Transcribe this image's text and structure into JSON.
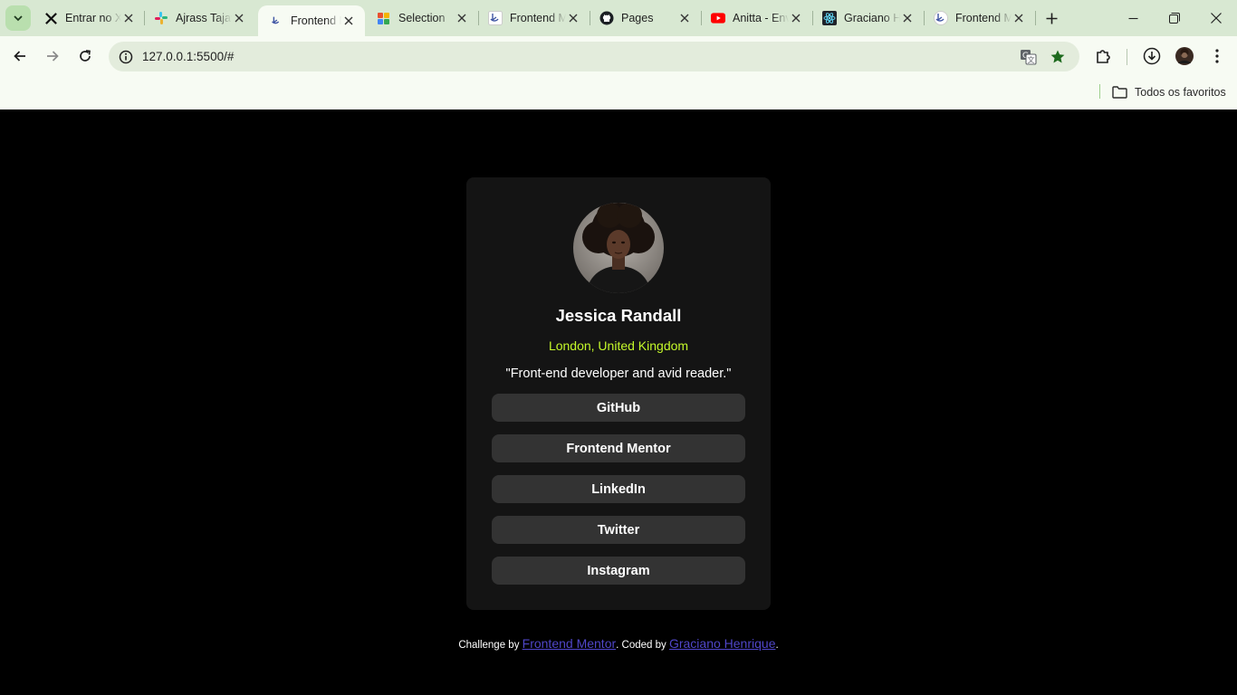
{
  "browser": {
    "tabs": [
      {
        "title": "Entrar no X",
        "icon": "x-logo-icon"
      },
      {
        "title": "Ajrass Tajawal",
        "icon": "slack-icon"
      },
      {
        "title": "Frontend Mentor",
        "icon": "frontend-mentor-icon",
        "active": true
      },
      {
        "title": "Selection",
        "icon": "selection-icon"
      },
      {
        "title": "Frontend Mentor",
        "icon": "frontend-mentor-icon"
      },
      {
        "title": "Pages",
        "icon": "github-icon"
      },
      {
        "title": "Anitta - Envolver",
        "icon": "youtube-icon"
      },
      {
        "title": "Graciano Henrique",
        "icon": "react-icon"
      },
      {
        "title": "Frontend Mentor",
        "icon": "frontend-mentor-icon"
      }
    ],
    "url": "127.0.0.1:5500/#",
    "bookmarks": {
      "all_label": "Todos os favoritos"
    },
    "colors": {
      "chrome": "#d8e8d2",
      "toolbar": "#f7fbf3",
      "bookmark_star": "#1e6a1e"
    }
  },
  "profile": {
    "name": "Jessica Randall",
    "location": "London, United Kingdom",
    "bio": "\"Front-end developer and avid reader.\"",
    "links": [
      {
        "label": "GitHub"
      },
      {
        "label": "Frontend Mentor"
      },
      {
        "label": "LinkedIn"
      },
      {
        "label": "Twitter"
      },
      {
        "label": "Instagram"
      }
    ],
    "colors": {
      "background": "#000000",
      "card": "#141414",
      "button": "#333333",
      "accent": "#c4f82a"
    }
  },
  "footer": {
    "prefix": "Challenge by ",
    "challenge_link": "Frontend Mentor",
    "middle": ". Coded by ",
    "author_link": "Graciano Henrique",
    "suffix": "."
  }
}
